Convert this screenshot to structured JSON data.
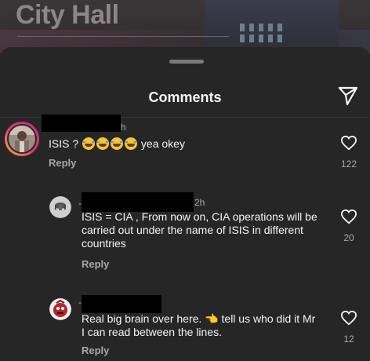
{
  "background": {
    "title": "City Hall"
  },
  "sheet": {
    "title": "Comments",
    "send_icon": "send-icon"
  },
  "comments": [
    {
      "time": "h",
      "text_before_emoji": "ISIS ?",
      "emoji_count": 4,
      "emoji_icon": "face-with-tears-of-joy-icon",
      "text_after_emoji": "yea okey",
      "reply_label": "Reply",
      "likes": "122",
      "avatar_icon": "person-avatar-icon",
      "is_reply": false
    },
    {
      "time": "2h",
      "prefix": "-",
      "text": "ISIS =  CIA ,  From now on, CIA operations will be carried out under the name of ISIS in different countries",
      "reply_label": "Reply",
      "likes": "20",
      "avatar_icon": "default-avatar-icon",
      "is_reply": true
    },
    {
      "time": "",
      "prefix": "-",
      "text": "Real big brain over here. 👈 tell us who did it Mr I can read between the lines.",
      "reply_label": "Reply",
      "likes": "12",
      "avatar_icon": "red-character-avatar-icon",
      "is_reply": true
    }
  ],
  "colors": {
    "background": "#262626",
    "text_primary": "#f5f5f5",
    "text_secondary": "#a8a8a8",
    "story_ring_start": "#c13584",
    "story_ring_end": "#fcaf45"
  }
}
